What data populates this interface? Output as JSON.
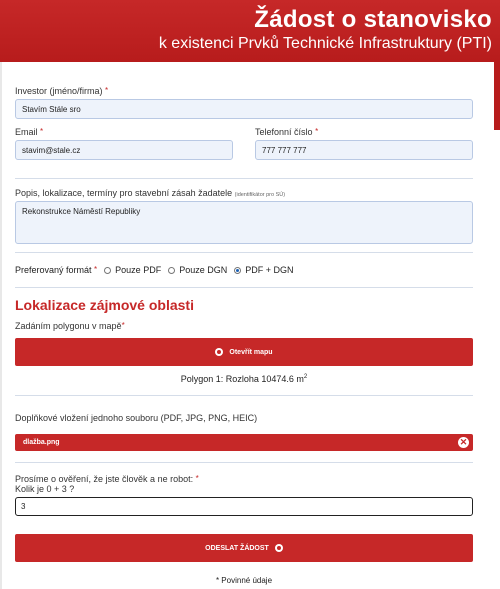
{
  "header": {
    "title": "Žádost o stanovisko",
    "subtitle": "k existenci Prvků Technické Infrastruktury (PTI)"
  },
  "investor": {
    "label": "Investor (jméno/firma)",
    "required": "*",
    "value": "Stavím Stále sro"
  },
  "email": {
    "label": "Email",
    "required": "*",
    "value": "stavim@stale.cz"
  },
  "phone": {
    "label": "Telefonní číslo",
    "required": "*",
    "value": "777 777 777"
  },
  "description": {
    "label": "Popis, lokalizace, termíny pro stavební zásah žadatele",
    "hint": "(identifikátor pro SÚ)",
    "value": "Rekonstrukce Náměstí Republiky"
  },
  "format": {
    "label": "Preferovaný formát",
    "required": "*",
    "options": [
      "Pouze PDF",
      "Pouze DGN",
      "PDF + DGN"
    ],
    "selected": "PDF + DGN"
  },
  "location": {
    "section_title": "Lokalizace zájmové oblasti",
    "polygon_label": "Zadáním polygonu v mapě",
    "polygon_required": "*",
    "open_map_label": "Otevřít mapu",
    "polygon_info": "Polygon 1: Rozloha 10474.6 m",
    "polygon_unit_sup": "2"
  },
  "upload": {
    "label": "Doplňkové vložení jednoho souboru (PDF, JPG, PNG, HEIC)",
    "file_name": "dlažba.png"
  },
  "captcha": {
    "label": "Prosíme o ověření, že jste člověk a ne robot:",
    "required": "*",
    "question": "Kolik je 0 + 3 ?",
    "value": "3"
  },
  "submit": {
    "label": "ODESLAT ŽÁDOST"
  },
  "footnote": "* Povinné údaje",
  "colors": {
    "accent": "#c62828",
    "input_bg": "#eef3fb",
    "input_border": "#b9c9e4"
  }
}
